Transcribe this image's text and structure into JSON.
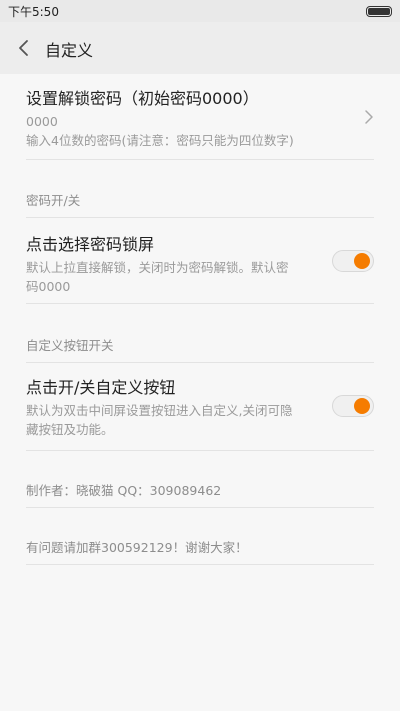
{
  "status_bar": {
    "time": "下午5:50"
  },
  "header": {
    "title": "自定义"
  },
  "password": {
    "title": "设置解锁密码（初始密码0000）",
    "value": "0000",
    "hint": "输入4位数的密码(请注意：密码只能为四位数字)"
  },
  "sections": {
    "password_switch": "密码开/关",
    "custom_button_switch": "自定义按钮开关"
  },
  "lock_toggle": {
    "title": "点击选择密码锁屏",
    "desc_line1": "默认上拉直接解锁，关闭时为密码解锁。默认密",
    "desc_line2": "码0000",
    "on": true
  },
  "button_toggle": {
    "title": "点击开/关自定义按钮",
    "desc_line1": "默认为双击中间屏设置按钮进入自定义,关闭可隐",
    "desc_line2": "藏按钮及功能。",
    "on": true
  },
  "info": {
    "author": "制作者：晓破猫 QQ：309089462",
    "contact": "有问题请加群300592129！谢谢大家！"
  },
  "colors": {
    "accent": "#f57c00"
  }
}
